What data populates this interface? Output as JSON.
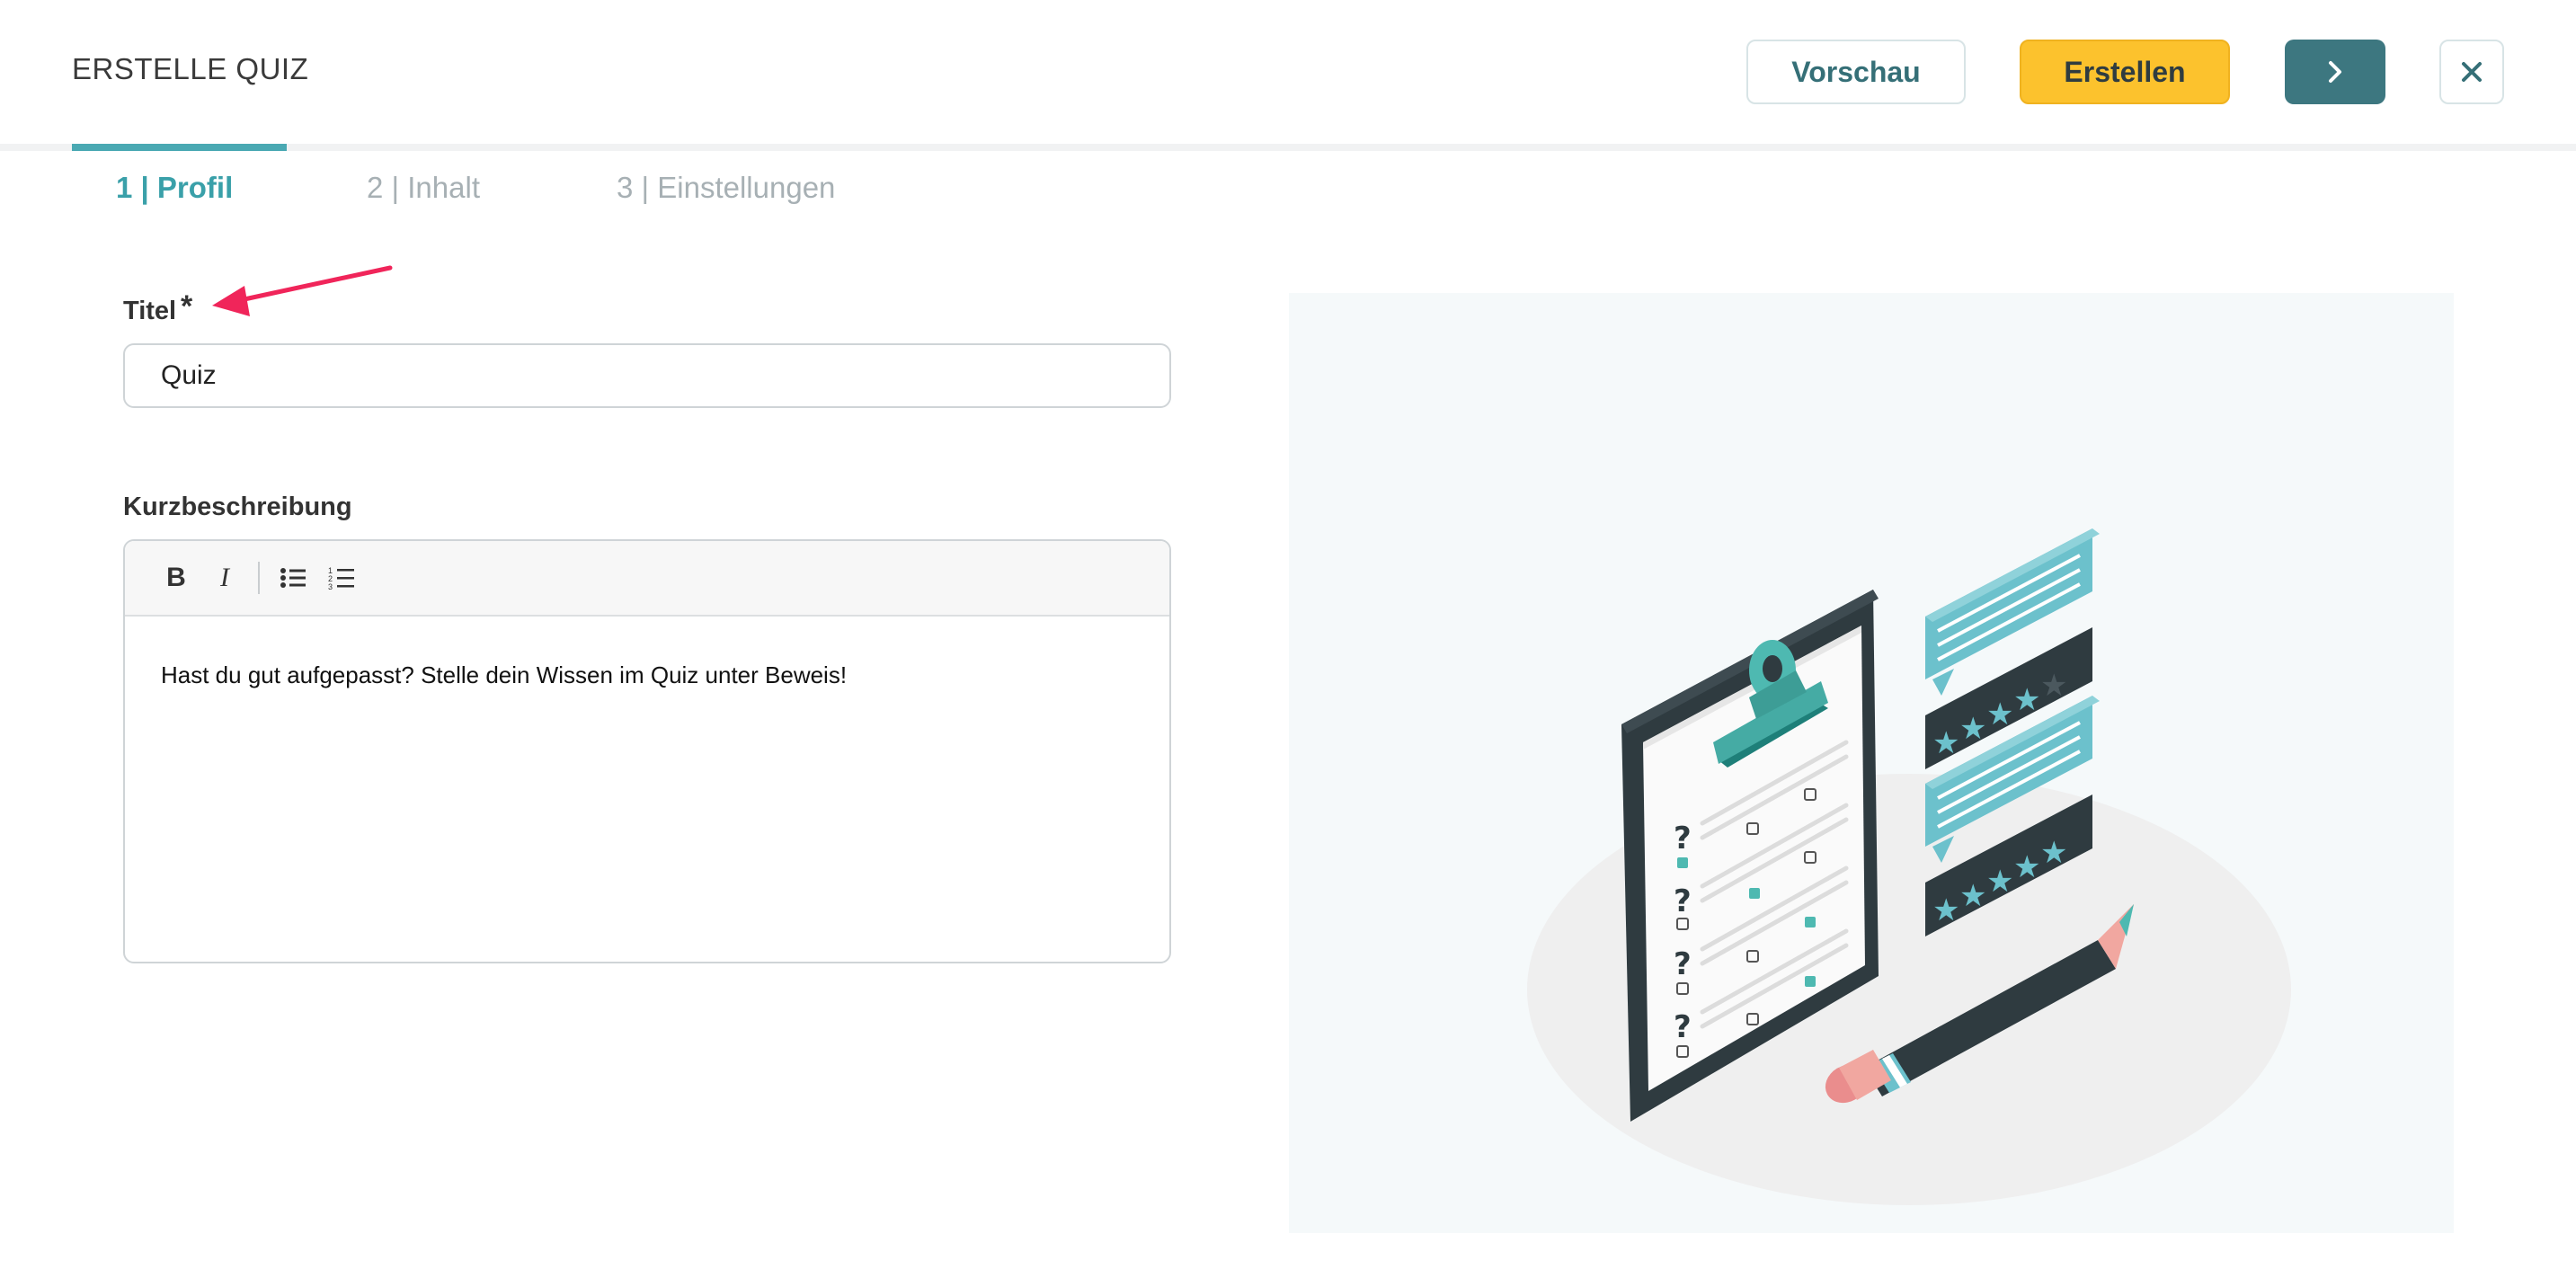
{
  "header": {
    "title": "ERSTELLE QUIZ",
    "preview_label": "Vorschau",
    "create_label": "Erstellen",
    "next_icon": "chevron-right-icon",
    "close_icon": "close-icon"
  },
  "tabs": [
    {
      "label": "1 | Profil",
      "active": true
    },
    {
      "label": "2 | Inhalt",
      "active": false
    },
    {
      "label": "3 | Einstellungen",
      "active": false
    }
  ],
  "form": {
    "title_label": "Titel",
    "required_mark": "*",
    "title_value": "Quiz",
    "description_label": "Kurzbeschreibung",
    "toolbar": {
      "bold": "B",
      "italic": "I",
      "bullet_list_icon": "bullet-list-icon",
      "numbered_list_icon": "numbered-list-icon"
    },
    "description_value": "Hast du gut aufgepasst? Stelle dein Wissen im Quiz unter Beweis!"
  },
  "colors": {
    "accent": "#3aa0a9",
    "primary_button": "#fcc22d",
    "next_button": "#3d7780",
    "annotation_arrow": "#f0255a"
  }
}
